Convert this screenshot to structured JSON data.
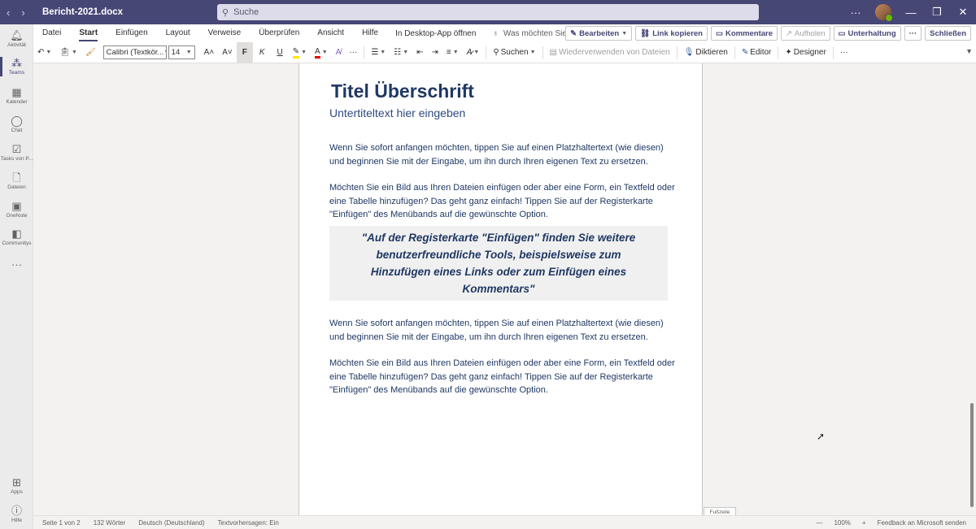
{
  "window": {
    "doc_title": "Bericht-2021.docx",
    "search_placeholder": "Suche",
    "nav_back": "‹",
    "nav_forward": "›",
    "more": "···",
    "minimize": "—",
    "restore": "❐",
    "close": "✕"
  },
  "rail": {
    "items": [
      {
        "label": "Aktivität",
        "icon": "bell-icon"
      },
      {
        "label": "Teams",
        "icon": "teams-icon"
      },
      {
        "label": "Kalender",
        "icon": "calendar-icon"
      },
      {
        "label": "Chat",
        "icon": "chat-icon"
      },
      {
        "label": "Tasks von P...",
        "icon": "tasks-icon"
      },
      {
        "label": "Dateien",
        "icon": "files-icon"
      },
      {
        "label": "OneNote",
        "icon": "onenote-icon"
      },
      {
        "label": "Communitys",
        "icon": "community-icon"
      },
      {
        "label": "···",
        "icon": "more-icon"
      },
      {
        "label": "Apps",
        "icon": "apps-icon"
      },
      {
        "label": "Hilfe",
        "icon": "help-icon"
      }
    ]
  },
  "menu": {
    "tabs": [
      "Datei",
      "Start",
      "Einfügen",
      "Layout",
      "Verweise",
      "Überprüfen",
      "Ansicht",
      "Hilfe"
    ],
    "open_desktop": "In Desktop-App öffnen",
    "tell_me": "Was möchten Sie tun?",
    "edit": "Bearbeiten",
    "copy_link": "Link kopieren",
    "comments": "Kommentare",
    "catch_up": "Aufholen",
    "conversation": "Unterhaltung",
    "more": "···",
    "close": "Schließen"
  },
  "toolbar": {
    "font": "Calibri (Textkör...",
    "size": "14",
    "grow": "A˄",
    "shrink": "A˅",
    "bold": "F",
    "italic": "K",
    "underline": "U",
    "search": "Suchen",
    "reuse": "Wiederverwenden von Dateien",
    "dictate": "Diktieren",
    "editor": "Editor",
    "designer": "Designer",
    "more": "···"
  },
  "document": {
    "title": "Titel Überschrift",
    "subtitle": "Untertiteltext hier eingeben",
    "para1": "Wenn Sie sofort anfangen möchten, tippen Sie auf einen Platzhaltertext (wie diesen) und beginnen Sie mit der Eingabe, um ihn durch Ihren eigenen Text zu ersetzen.",
    "para2": "Möchten Sie ein Bild aus Ihren Dateien einfügen oder aber eine Form, ein Textfeld oder eine Tabelle hinzufügen? Das geht ganz einfach! Tippen Sie auf der Registerkarte \"Einfügen\" des Menübands auf die gewünschte Option.",
    "quote": "\"Auf der Registerkarte \"Einfügen\" finden Sie weitere benutzerfreundliche Tools, beispielsweise zum Hinzufügen eines Links oder zum Einfügen eines Kommentars\"",
    "para3": "Wenn Sie sofort anfangen möchten, tippen Sie auf einen Platzhaltertext (wie diesen) und beginnen Sie mit der Eingabe, um ihn durch Ihren eigenen Text zu ersetzen.",
    "para4": "Möchten Sie ein Bild aus Ihren Dateien einfügen oder aber eine Form, ein Textfeld oder eine Tabelle hinzufügen? Das geht ganz einfach! Tippen Sie auf der Registerkarte \"Einfügen\" des Menübands auf die gewünschte Option.",
    "footnote_tab": "Fußzeile"
  },
  "status": {
    "page": "Seite 1 von 2",
    "words": "132 Wörter",
    "language": "Deutsch (Deutschland)",
    "predictions": "Textvorhersagen: Ein",
    "zoom_out": "—",
    "zoom": "100%",
    "zoom_in": "+",
    "feedback": "Feedback an Microsoft senden"
  },
  "colors": {
    "teams_purple": "#464775",
    "doc_heading": "#1f3864"
  }
}
